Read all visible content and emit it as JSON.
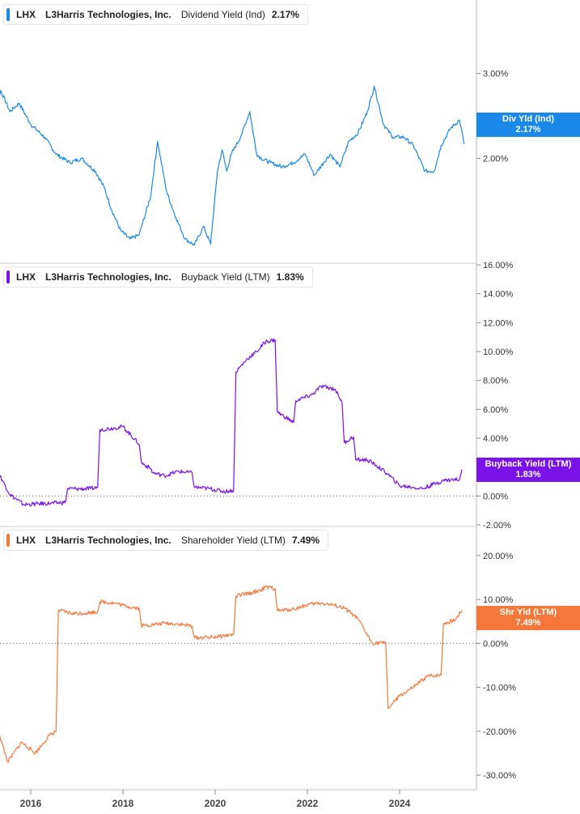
{
  "company": "L3Harris Technologies, Inc.",
  "ticker": "LHX",
  "x_tick_labels": [
    "2016",
    "2018",
    "2020",
    "2022",
    "2024"
  ],
  "chart_data": [
    {
      "type": "line",
      "metric": "Dividend Yield (Ind)",
      "current_value": "2.17%",
      "tag_label": "Div Yld (Ind)",
      "color": "#1a88e8",
      "y_tick_labels": [
        "3.00%",
        "2.00%"
      ],
      "y_ticks": [
        3.0,
        2.0
      ],
      "ylim": [
        0.88,
        3.75
      ],
      "zero_line": false,
      "series": [
        {
          "name": "Dividend Yield (Ind)",
          "x": [
            2015.0,
            2015.2,
            2015.35,
            2015.55,
            2015.75,
            2016.0,
            2016.3,
            2016.55,
            2016.85,
            2017.1,
            2017.4,
            2017.6,
            2017.75,
            2017.95,
            2018.15,
            2018.35,
            2018.6,
            2018.75,
            2018.95,
            2019.15,
            2019.35,
            2019.55,
            2019.75,
            2019.9,
            2020.05,
            2020.15,
            2020.25,
            2020.35,
            2020.55,
            2020.75,
            2020.9,
            2021.0,
            2021.2,
            2021.45,
            2021.7,
            2021.95,
            2022.15,
            2022.35,
            2022.5,
            2022.7,
            2022.9,
            2023.1,
            2023.3,
            2023.45,
            2023.65,
            2023.85,
            2024.1,
            2024.3,
            2024.55,
            2024.75,
            2024.9,
            2025.1,
            2025.3,
            2025.4
          ],
          "values": [
            2.45,
            2.4,
            2.8,
            2.55,
            2.65,
            2.4,
            2.25,
            2.05,
            1.95,
            2.0,
            1.85,
            1.65,
            1.4,
            1.15,
            1.05,
            1.1,
            1.55,
            2.2,
            1.6,
            1.3,
            1.05,
            0.98,
            1.2,
            0.99,
            1.85,
            2.1,
            1.85,
            2.05,
            2.25,
            2.55,
            2.05,
            2.0,
            1.95,
            1.9,
            1.95,
            2.05,
            1.8,
            1.95,
            2.05,
            1.9,
            2.2,
            2.3,
            2.55,
            2.85,
            2.4,
            2.25,
            2.25,
            2.15,
            1.85,
            1.85,
            2.15,
            2.35,
            2.45,
            2.17
          ]
        }
      ]
    },
    {
      "type": "line",
      "metric": "Buyback Yield (LTM)",
      "current_value": "1.83%",
      "tag_label": "Buyback Yield (LTM)",
      "color": "#7b12ea",
      "y_tick_labels": [
        "16.00%",
        "14.00%",
        "12.00%",
        "10.00%",
        "8.00%",
        "6.00%",
        "4.00%",
        "0.00%",
        "-2.00%"
      ],
      "y_ticks": [
        16,
        14,
        12,
        10,
        8,
        6,
        4,
        0,
        -2
      ],
      "ylim": [
        -2,
        16
      ],
      "zero_line": true,
      "series": [
        {
          "name": "Buyback Yield (LTM)",
          "x": [
            2015.0,
            2015.1,
            2015.3,
            2015.55,
            2015.85,
            2016.15,
            2016.45,
            2016.75,
            2016.8,
            2017.0,
            2017.3,
            2017.45,
            2017.5,
            2017.8,
            2018.0,
            2018.35,
            2018.4,
            2018.6,
            2018.65,
            2018.9,
            2019.2,
            2019.5,
            2019.55,
            2019.9,
            2020.2,
            2020.4,
            2020.45,
            2020.7,
            2020.9,
            2021.1,
            2021.3,
            2021.35,
            2021.7,
            2021.75,
            2022.1,
            2022.3,
            2022.6,
            2022.75,
            2022.8,
            2023.0,
            2023.05,
            2023.3,
            2023.5,
            2023.75,
            2024.0,
            2024.3,
            2024.5,
            2024.8,
            2025.0,
            2025.3,
            2025.35
          ],
          "values": [
            2.6,
            2.0,
            1.6,
            0.1,
            -0.6,
            -0.55,
            -0.5,
            -0.45,
            0.5,
            0.5,
            0.5,
            0.6,
            4.6,
            4.7,
            4.8,
            3.6,
            2.3,
            1.9,
            1.6,
            1.4,
            1.7,
            1.6,
            0.6,
            0.5,
            0.3,
            0.4,
            8.6,
            9.5,
            10.0,
            10.7,
            10.8,
            5.8,
            5.1,
            6.6,
            7.0,
            7.6,
            7.4,
            6.5,
            3.7,
            4.1,
            2.5,
            2.5,
            2.1,
            1.5,
            0.7,
            0.6,
            0.5,
            0.9,
            1.1,
            1.15,
            1.83
          ]
        }
      ]
    },
    {
      "type": "line",
      "metric": "Shareholder Yield (LTM)",
      "current_value": "7.49%",
      "tag_label": "Shr Yld (LTM)",
      "color": "#f5783a",
      "y_tick_labels": [
        "20.00%",
        "10.00%",
        "0.00%",
        "-10.00%",
        "-20.00%",
        "-30.00%"
      ],
      "y_ticks": [
        20,
        10,
        0,
        -10,
        -20,
        -30
      ],
      "ylim": [
        -32.4,
        24.4
      ],
      "zero_line": true,
      "series": [
        {
          "name": "Shareholder Yield (LTM)",
          "x": [
            2015.0,
            2015.25,
            2015.3,
            2015.5,
            2015.8,
            2016.1,
            2016.4,
            2016.55,
            2016.6,
            2016.9,
            2017.2,
            2017.45,
            2017.5,
            2017.8,
            2018.1,
            2018.35,
            2018.4,
            2018.7,
            2018.9,
            2019.2,
            2019.5,
            2019.55,
            2019.9,
            2020.1,
            2020.4,
            2020.45,
            2020.8,
            2021.0,
            2021.1,
            2021.3,
            2021.35,
            2021.7,
            2022.0,
            2022.3,
            2022.6,
            2022.8,
            2023.0,
            2023.1,
            2023.4,
            2023.7,
            2023.75,
            2024.0,
            2024.3,
            2024.6,
            2024.9,
            2024.95,
            2025.2,
            2025.35
          ],
          "values": [
            5.2,
            5.0,
            -20.0,
            -27.0,
            -22.5,
            -25.0,
            -21.0,
            -20.0,
            7.5,
            6.8,
            6.9,
            7.2,
            9.5,
            9.2,
            8.4,
            8.0,
            4.0,
            4.3,
            4.6,
            4.4,
            3.9,
            1.3,
            1.4,
            1.6,
            2.0,
            10.8,
            11.5,
            12.2,
            12.8,
            12.5,
            7.4,
            7.8,
            8.8,
            9.2,
            8.6,
            8.0,
            6.4,
            5.5,
            0.1,
            0.1,
            -14.8,
            -12.0,
            -10.0,
            -7.5,
            -7.2,
            4.5,
            5.3,
            7.49
          ]
        }
      ]
    }
  ]
}
